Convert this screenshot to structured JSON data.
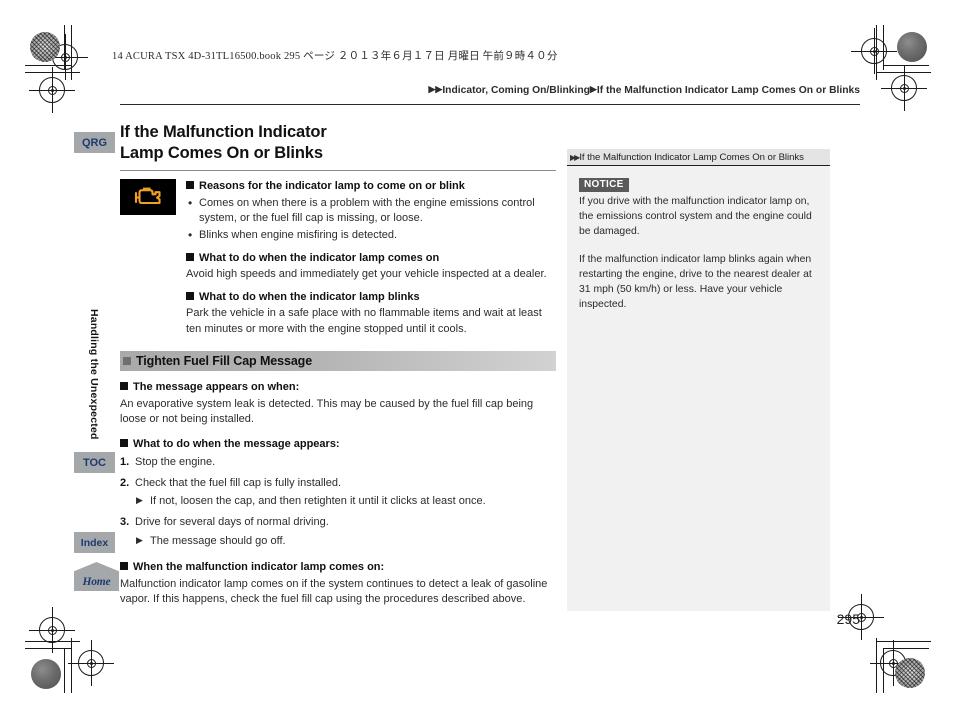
{
  "slug": "14 ACURA TSX 4D-31TL16500.book   295 ページ   ２０１３年６月１７日   月曜日   午前９時４０分",
  "breadcrumb": {
    "arrow_double": "▶▶",
    "arrow_single": "▶",
    "parent": "Indicator, Coming On/Blinking",
    "current": "If the Malfunction Indicator Lamp Comes On or Blinks"
  },
  "margin_tabs": {
    "qrg": "QRG",
    "toc": "TOC",
    "index": "Index",
    "home": "Home",
    "chapter": "Handling the Unexpected"
  },
  "main": {
    "title_line1": "If the Malfunction Indicator",
    "title_line2": "Lamp Comes On or Blinks",
    "lamp_icon_name": "check-engine-lamp-icon",
    "reasons_heading": "Reasons for the indicator lamp to come on or blink",
    "reasons_bullets": [
      "Comes on when there is a problem with the engine emissions control system, or the fuel fill cap is missing, or loose.",
      "Blinks when engine misfiring is detected."
    ],
    "comes_on_heading": "What to do when the indicator lamp comes on",
    "comes_on_text": "Avoid high speeds and immediately get your vehicle inspected at a dealer.",
    "blinks_heading": "What to do when the indicator lamp blinks",
    "blinks_text": "Park the vehicle in a safe place with no flammable items and wait at least ten minutes or more with the engine stopped until it cools.",
    "section_bar_title": "Tighten Fuel Fill Cap Message",
    "appears_heading": "The message appears on when:",
    "appears_text": "An evaporative system leak is detected. This may be caused by the fuel fill cap being loose or not being installed.",
    "whattodo_heading": "What to do when the message appears:",
    "steps": [
      {
        "num": "1.",
        "text": "Stop the engine."
      },
      {
        "num": "2.",
        "text": "Check that the fuel fill cap is fully installed.",
        "sub": "If not, loosen the cap, and then retighten it until it clicks at least once."
      },
      {
        "num": "3.",
        "text": "Drive for several days of normal driving.",
        "sub": "The message should go off."
      }
    ],
    "lamp_on_heading": "When the malfunction indicator lamp comes on:",
    "lamp_on_text": "Malfunction indicator lamp comes on if the system continues to detect a leak of gasoline vapor. If this happens, check the fuel fill cap using the procedures described above."
  },
  "sidebar": {
    "header": "If the Malfunction Indicator Lamp Comes On or Blinks",
    "header_icon": "double-chevron-icon",
    "notice_label": "NOTICE",
    "notice_paragraphs": [
      "If you drive with the malfunction indicator lamp on, the emissions control system and the engine could be damaged.",
      "If the malfunction indicator lamp blinks again when restarting the engine, drive to the nearest dealer at 31 mph (50 km/h) or less. Have your vehicle inspected."
    ]
  },
  "page_number": "295",
  "colors": {
    "tab_gray": "#a5a8ab",
    "tab_text_navy": "#1f3a6e",
    "lamp_amber": "#f0a028",
    "notice_badge": "#5a5a5a",
    "sidebar_bg": "#f1f1f1"
  }
}
